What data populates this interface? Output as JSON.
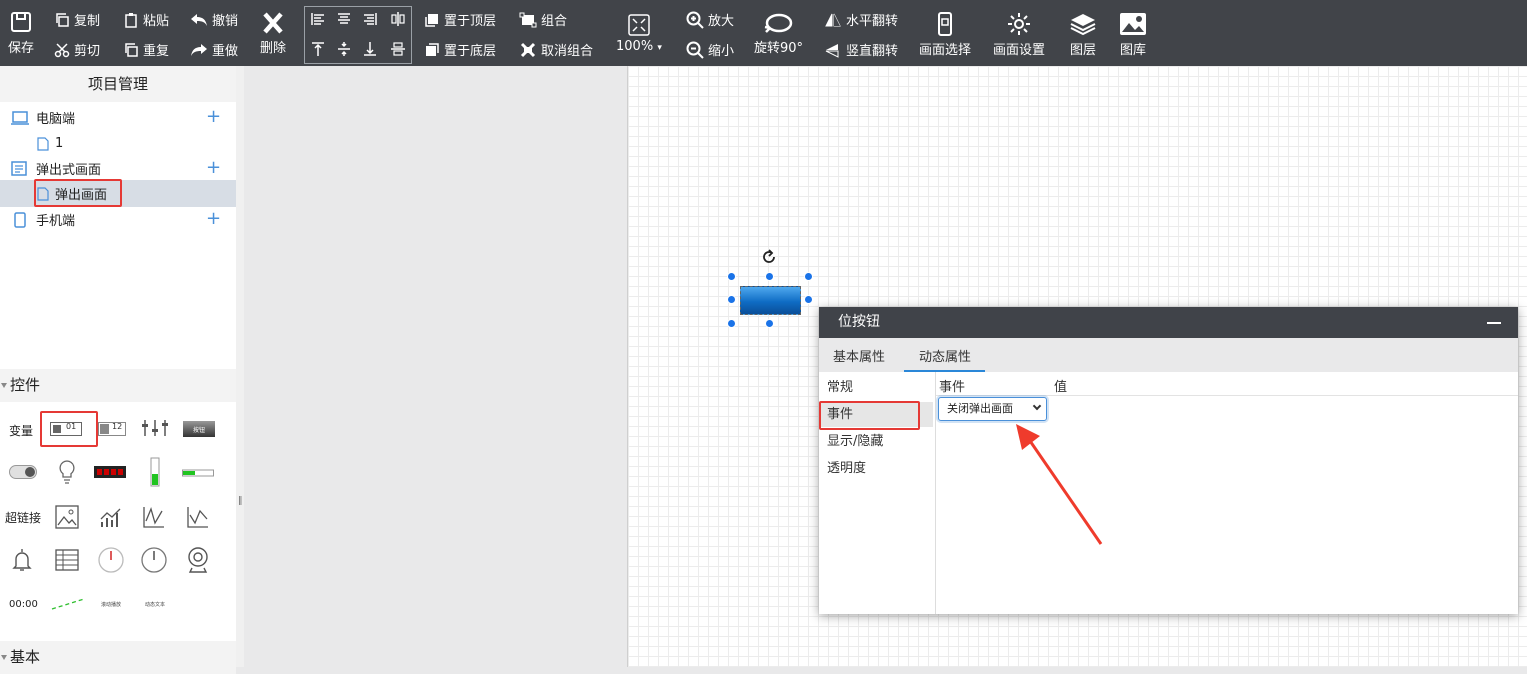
{
  "toolbar": {
    "save": "保存",
    "copy": "复制",
    "cut": "剪切",
    "paste": "粘贴",
    "repeat": "重复",
    "undo": "撤销",
    "redo": "重做",
    "delete": "删除",
    "bring_front": "置于顶层",
    "send_back": "置于底层",
    "group": "组合",
    "ungroup": "取消组合",
    "zoom_value": "100%",
    "zoom_in": "放大",
    "zoom_out": "缩小",
    "rotate90": "旋转90°",
    "flip_h": "水平翻转",
    "flip_v": "竖直翻转",
    "screen_select": "画面选择",
    "screen_settings": "画面设置",
    "layers": "图层",
    "gallery": "图库"
  },
  "project": {
    "title": "项目管理",
    "items": [
      {
        "label": "电脑端"
      },
      {
        "label": "1"
      },
      {
        "label": "弹出式画面"
      },
      {
        "label": "弹出画面"
      },
      {
        "label": "手机端"
      }
    ]
  },
  "controls": {
    "title": "控件",
    "label_variable": "变量",
    "label_hyperlink": "超链接",
    "value_01": "01",
    "value_12": "12",
    "button_text": "按钮",
    "time": "00:00",
    "scroll_text": "滚动播放",
    "dynamic_text": "动态文本"
  },
  "basic": {
    "title": "基本"
  },
  "dialog": {
    "title": "位按钮",
    "tabs": [
      "基本属性",
      "动态属性"
    ],
    "side_items": [
      "常规",
      "事件",
      "显示/隐藏",
      "透明度"
    ],
    "col_event": "事件",
    "col_value": "值",
    "event_value": "关闭弹出画面"
  },
  "colors": {
    "toolbar_bg": "#414449",
    "accent": "#1a73e8",
    "highlight": "#e53935"
  }
}
